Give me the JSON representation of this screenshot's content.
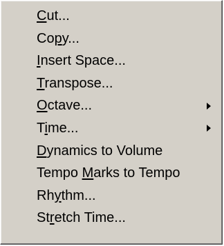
{
  "menu": {
    "items": [
      {
        "pre": "",
        "u": "C",
        "post": "ut...",
        "submenu": false
      },
      {
        "pre": "Co",
        "u": "p",
        "post": "y...",
        "submenu": false
      },
      {
        "pre": "",
        "u": "I",
        "post": "nsert Space...",
        "submenu": false
      },
      {
        "pre": "",
        "u": "T",
        "post": "ranspose...",
        "submenu": false
      },
      {
        "pre": "",
        "u": "O",
        "post": "ctave...",
        "submenu": true
      },
      {
        "pre": "T",
        "u": "i",
        "post": "me...",
        "submenu": true
      },
      {
        "pre": "",
        "u": "D",
        "post": "ynamics to Volume",
        "submenu": false
      },
      {
        "pre": "Tempo ",
        "u": "M",
        "post": "arks to Tempo",
        "submenu": false
      },
      {
        "pre": "Rh",
        "u": "y",
        "post": "thm...",
        "submenu": false
      },
      {
        "pre": "St",
        "u": "r",
        "post": "etch Time...",
        "submenu": false
      }
    ],
    "submenu_arrow_icon": "triangle-right-icon",
    "colors": {
      "background": "#d4d0c8",
      "text": "#000000"
    }
  }
}
